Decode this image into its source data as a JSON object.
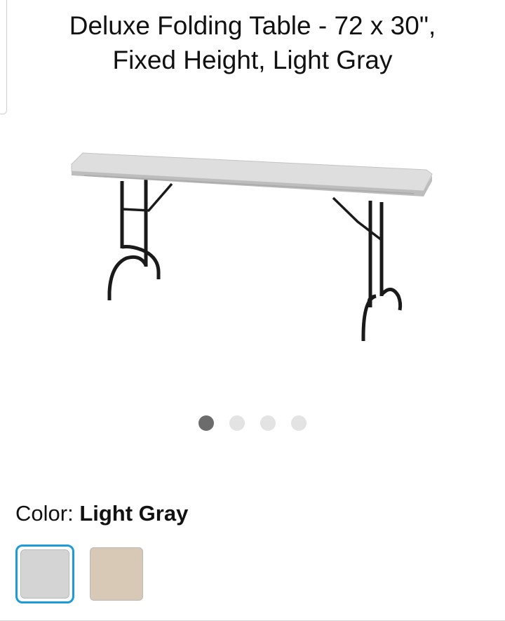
{
  "product": {
    "title_line1": "Deluxe Folding Table - 72 x 30\",",
    "title_line2": "Fixed Height, Light Gray",
    "image_icon": "folding-table-image"
  },
  "carousel": {
    "total": 4,
    "active_index": 0
  },
  "color": {
    "label": "Color: ",
    "selected_value": "Light Gray",
    "options": [
      {
        "hex": "#d4d4d4",
        "selected": true
      },
      {
        "hex": "#d8c8b6",
        "selected": false
      }
    ],
    "selected_border": "#1e9bd7"
  }
}
